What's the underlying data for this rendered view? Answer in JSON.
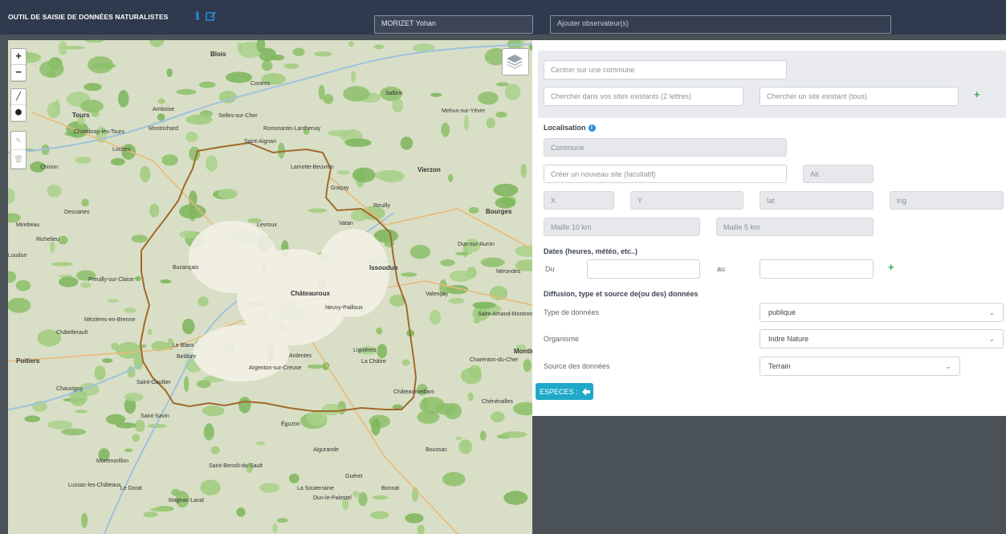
{
  "header": {
    "title": "OUTIL DE SAISIE DE DONNÉES NATURALISTES",
    "observer_value": "MORIZET Yohan",
    "add_observer_placeholder": "Ajouter observateur(s)"
  },
  "map": {
    "zoom_in": "+",
    "zoom_out": "−",
    "places": [
      "Blois",
      "Tours",
      "Amboise",
      "Chambray-lès-Tours",
      "Romorantin-Lanthenay",
      "Vierzon",
      "Bourges",
      "Issoudun",
      "Châteauroux",
      "Châtellerault",
      "Le Blanc",
      "Argenton-sur-Creuse",
      "La Châtre",
      "Poitiers",
      "Guéret",
      "Montluçon",
      "Saint-Amand-Montrond",
      "Valençay",
      "Levroux",
      "Buzançais",
      "Ardentes",
      "Neuvy-Pailloux",
      "Vatan",
      "Graçay",
      "Reuilly",
      "Lignières",
      "Châteaumeillant",
      "Aigurande",
      "Éguzon",
      "Saint-Benoît-du-Sault",
      "Saint-Gaultier",
      "Belâbre",
      "Mézières-en-Brenne",
      "Loches",
      "Montrichard",
      "Selles-sur-Cher",
      "Saint-Aignan",
      "Contres",
      "Lamotte-Beuvron",
      "Salbris",
      "Mehun-sur-Yèvre",
      "Dun-sur-Auron",
      "Charenton-du-Cher",
      "Nérondes",
      "La Souterraine",
      "Bonnat",
      "Dun-le-Palestel",
      "Boussac",
      "Chénérailles",
      "Montmorillon",
      "Lussac-les-Châteaux",
      "Saint-Savin",
      "Preuilly-sur-Claise",
      "Descartes",
      "Chinon",
      "Richelieu",
      "Loudun",
      "Mirebeau",
      "Chauvigny",
      "Le Dorat",
      "Magnac-Laval"
    ]
  },
  "form": {
    "center_commune_placeholder": "Centrer sur une commune",
    "search_own_sites_placeholder": "Chercher dans vos sites existants (2 lettres)",
    "search_all_sites_placeholder": "Chercher un site existant (tous)",
    "plus": "+",
    "localisation_title": "Localisation",
    "info_glyph": "i",
    "commune_placeholder": "Commune",
    "new_site_placeholder": "Créer un nouveau site (facultatif)",
    "alt_placeholder": "Alt.",
    "x_placeholder": "X",
    "y_placeholder": "Y",
    "lat_placeholder": "lat",
    "lng_placeholder": "lng",
    "maille10_placeholder": "Maille 10 km",
    "maille5_placeholder": "Maille 5 km",
    "dates_title": "Dates (heures, météo, etc..)",
    "date_from_label": "Du",
    "date_to_label": "au",
    "diffusion_title": "Diffusion, type et source de(ou des) données",
    "type_label": "Type de données",
    "type_value": "publique",
    "organisme_label": "Organisme",
    "organisme_value": "Indre Nature",
    "source_label": "Source des données",
    "source_value": "Terrain",
    "especes_label": "ESPECES :"
  },
  "colors": {
    "header_bg": "#2f3a4e",
    "accent_green": "#3aa55a",
    "button_cyan": "#20a8c9",
    "boundary": "#a0692b"
  }
}
